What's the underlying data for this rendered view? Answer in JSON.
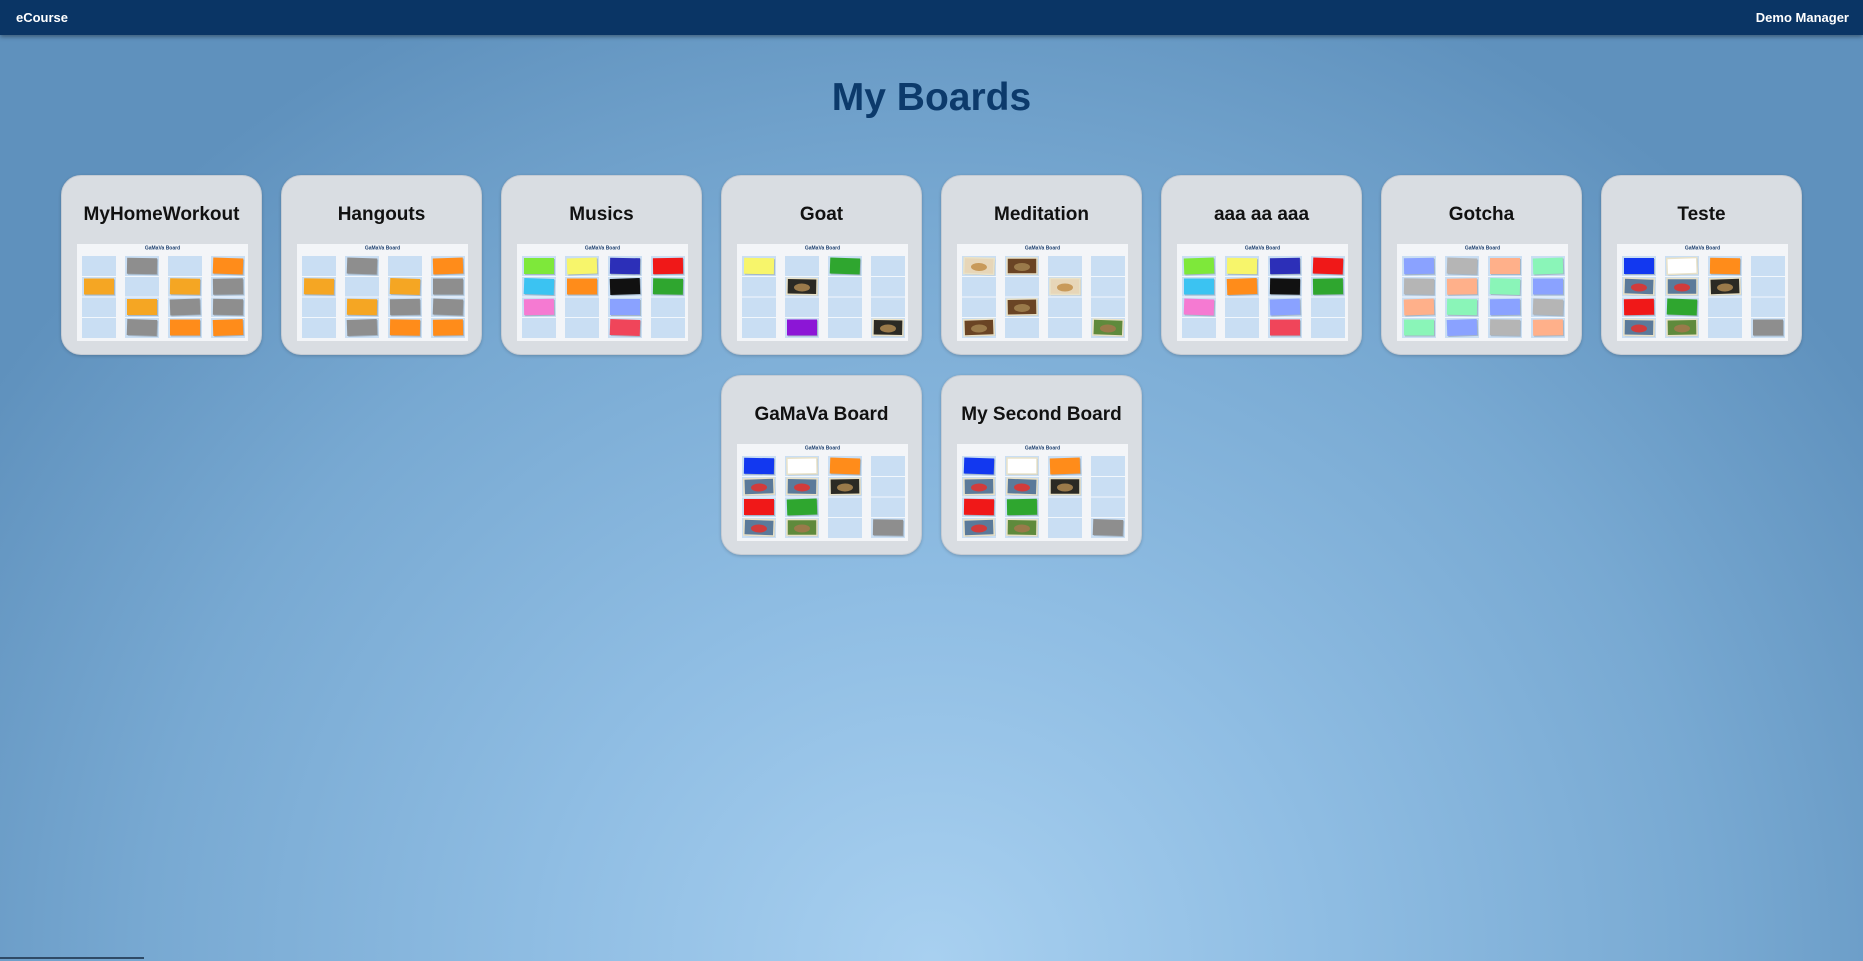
{
  "header": {
    "brand": "eCourse",
    "user": "Demo Manager"
  },
  "page": {
    "title": "My Boards"
  },
  "boards": [
    {
      "title": "MyHomeWorkout",
      "preview_title": "GaMaVa Board",
      "cells": [
        [
          "",
          "gray",
          "",
          "orange"
        ],
        [
          "amber",
          "",
          "amber",
          "gray"
        ],
        [
          "",
          "amber",
          "gray",
          "gray"
        ],
        [
          "",
          "gray",
          "orange",
          "orange"
        ]
      ]
    },
    {
      "title": "Hangouts",
      "preview_title": "GaMaVa Board",
      "cells": [
        [
          "",
          "gray",
          "",
          "orange"
        ],
        [
          "amber",
          "",
          "amber",
          "gray"
        ],
        [
          "",
          "amber",
          "gray",
          "gray"
        ],
        [
          "",
          "gray",
          "orange",
          "orange"
        ]
      ]
    },
    {
      "title": "Musics",
      "preview_title": "GaMaVa Board",
      "cells": [
        [
          "lime",
          "yellow",
          "navy",
          "red"
        ],
        [
          "cyan",
          "orange",
          "black",
          "green"
        ],
        [
          "pink",
          "",
          "periwinkle",
          ""
        ],
        [
          "",
          "",
          "crimson",
          ""
        ]
      ]
    },
    {
      "title": "Goat",
      "preview_title": "GaMaVa Board",
      "cells": [
        [
          "yellow",
          "",
          "green",
          ""
        ],
        [
          "",
          "photo-dark",
          "",
          ""
        ],
        [
          "",
          "",
          "",
          ""
        ],
        [
          "",
          "purple",
          "",
          "photo-dark"
        ]
      ]
    },
    {
      "title": "Meditation",
      "preview_title": "GaMaVa Board",
      "cells": [
        [
          "photo-light",
          "photo-brown",
          "",
          ""
        ],
        [
          "",
          "",
          "photo-light",
          ""
        ],
        [
          "",
          "photo-brown",
          "",
          ""
        ],
        [
          "photo-brown",
          "",
          "",
          "photo-green"
        ]
      ]
    },
    {
      "title": "aaa aa aaa",
      "preview_title": "GaMaVa Board",
      "cells": [
        [
          "lime",
          "yellow",
          "navy",
          "red"
        ],
        [
          "cyan",
          "orange",
          "black",
          "green"
        ],
        [
          "pink",
          "",
          "periwinkle",
          ""
        ],
        [
          "",
          "",
          "crimson",
          ""
        ]
      ]
    },
    {
      "title": "Gotcha",
      "preview_title": "GaMaVa Board",
      "cells": [
        [
          "periwinkle",
          "silver",
          "salmon",
          "mint"
        ],
        [
          "silver",
          "salmon",
          "mint",
          "periwinkle"
        ],
        [
          "salmon",
          "mint",
          "periwinkle",
          "silver"
        ],
        [
          "mint",
          "periwinkle",
          "silver",
          "salmon"
        ]
      ]
    },
    {
      "title": "Teste",
      "preview_title": "GaMaVa Board",
      "cells": [
        [
          "blue",
          "white",
          "orange",
          ""
        ],
        [
          "photo-car",
          "photo-car",
          "photo-dark",
          ""
        ],
        [
          "red",
          "green",
          "",
          ""
        ],
        [
          "photo-car",
          "photo-green",
          "",
          "gray"
        ]
      ]
    },
    {
      "title": "GaMaVa Board",
      "preview_title": "GaMaVa Board",
      "cells": [
        [
          "blue",
          "white",
          "orange",
          ""
        ],
        [
          "photo-car",
          "photo-car",
          "photo-dark",
          ""
        ],
        [
          "red",
          "green",
          "",
          ""
        ],
        [
          "photo-car",
          "photo-green",
          "",
          "gray"
        ]
      ]
    },
    {
      "title": "My Second Board",
      "preview_title": "GaMaVa Board",
      "cells": [
        [
          "blue",
          "white",
          "orange",
          ""
        ],
        [
          "photo-car",
          "photo-car",
          "photo-dark",
          ""
        ],
        [
          "red",
          "green",
          "",
          ""
        ],
        [
          "photo-car",
          "photo-green",
          "",
          "gray"
        ]
      ]
    }
  ],
  "colors": {
    "topbar": "#0a3565",
    "title": "#0c3a6b",
    "card": "#d9dde2",
    "swatches": {
      "gray": "#8e8e8e",
      "orange": "#ff8c1a",
      "amber": "#f5a623",
      "lime": "#7ee83a",
      "yellow": "#f7f56b",
      "navy": "#2c2fb8",
      "red": "#f01818",
      "cyan": "#3bc3f2",
      "black": "#111111",
      "green": "#2fa62f",
      "pink": "#f57ad2",
      "periwinkle": "#8aa2ff",
      "crimson": "#f0455a",
      "purple": "#8c16d6",
      "silver": "#b5b5b5",
      "salmon": "#ffb08a",
      "mint": "#8af5b8",
      "blue": "#1238f0",
      "white": "#ffffff",
      "photo-dark": "#2b2a24",
      "photo-light": "#e7d6b8",
      "photo-brown": "#6a4424",
      "photo-green": "#5f8a3c",
      "photo-car": "#5b7a9a"
    }
  }
}
